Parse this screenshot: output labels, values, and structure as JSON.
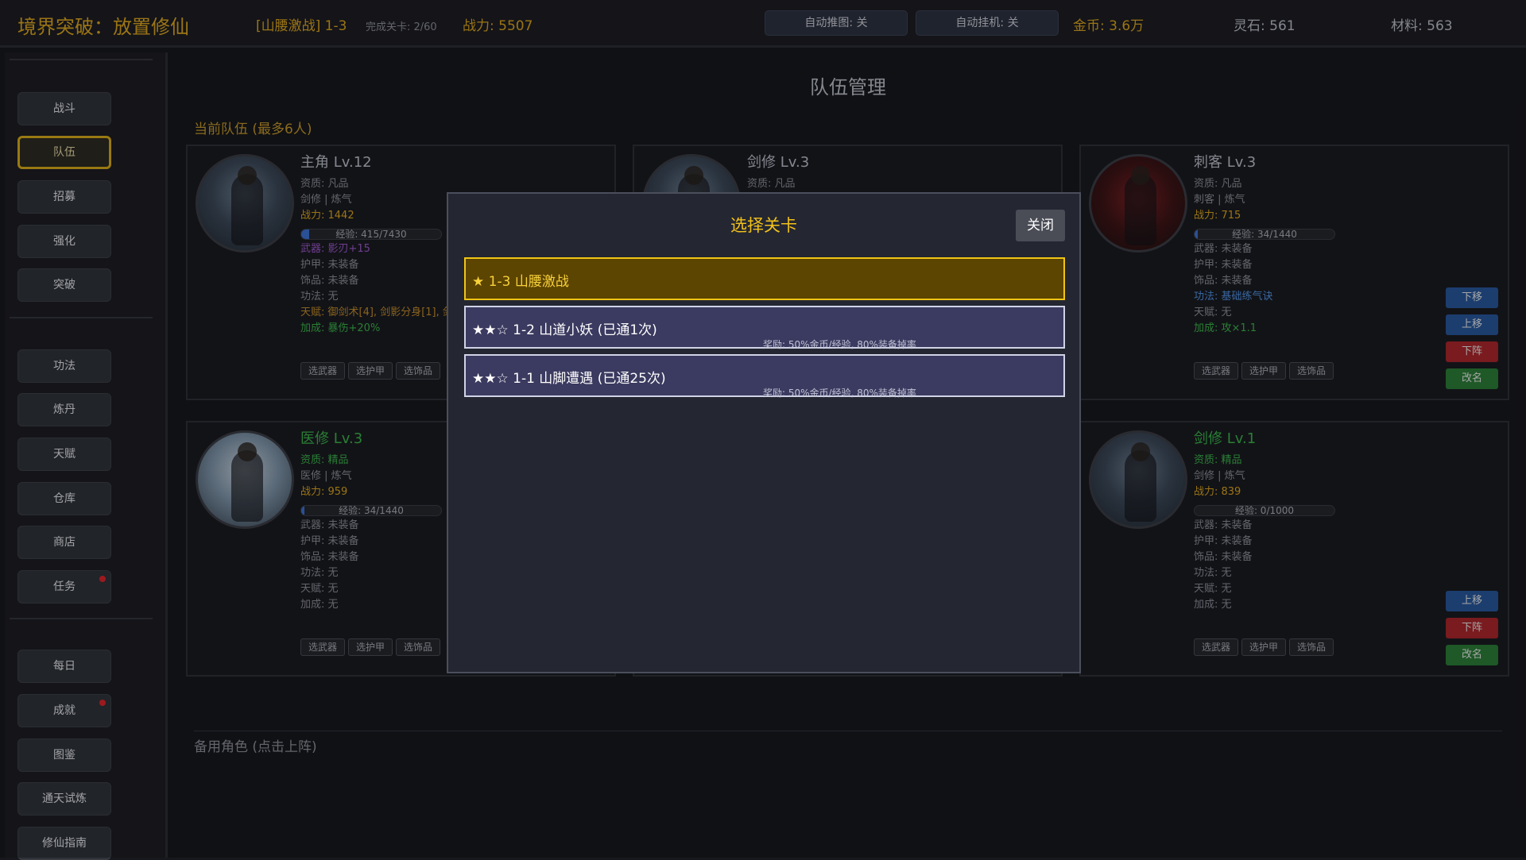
{
  "topbar": {
    "title": "境界突破：放置修仙",
    "stage": "[山腰激战] 1-3",
    "cleared": "完成关卡: 2/60",
    "power": "战力: 5507",
    "auto_push": "自动推图: 关",
    "auto_idle": "自动挂机: 关",
    "gold": "金币: 3.6万",
    "spirit_stone": "灵石: 561",
    "materials": "材料: 563"
  },
  "sidebar": {
    "group1": [
      "战斗",
      "队伍",
      "招募",
      "强化",
      "突破"
    ],
    "group2": [
      "功法",
      "炼丹",
      "天赋",
      "仓库",
      "商店",
      "任务"
    ],
    "group3": [
      "每日",
      "成就",
      "图鉴",
      "通天试炼",
      "修仙指南"
    ],
    "active": "队伍"
  },
  "main": {
    "title": "队伍管理",
    "current_team": "当前队伍 (最多6人)",
    "reserve": "备用角色 (点击上阵)"
  },
  "equip_buttons": [
    "选武器",
    "选护甲",
    "选饰品"
  ],
  "actions": {
    "down": "下移",
    "up": "上移",
    "remove": "下阵",
    "rename": "改名"
  },
  "cards": [
    {
      "name": "主角 Lv.12",
      "aptitude": "资质: 凡品",
      "class": "剑修 | 炼气",
      "power": "战力: 1442",
      "exp": "经验: 415/7430",
      "exp_fraction": 0.056,
      "weapon": "武器: 影刃+15",
      "armor": "护甲: 未装备",
      "accessory": "饰品: 未装备",
      "skill": "功法: 无",
      "talent": "天赋: 御剑术[4], 剑影分身[1], 剑",
      "bonus": "加成: 暴伤+20%"
    },
    {
      "name": "剑修 Lv.3",
      "aptitude": "资质: 凡品"
    },
    {
      "name": "刺客 Lv.3",
      "aptitude": "资质: 凡品",
      "class": "刺客 | 炼气",
      "power": "战力: 715",
      "exp": "经验: 34/1440",
      "exp_fraction": 0.024,
      "weapon": "武器: 未装备",
      "armor": "护甲: 未装备",
      "accessory": "饰品: 未装备",
      "skill": "功法: 基础练气诀",
      "talent": "天赋: 无",
      "bonus": "加成: 攻×1.1"
    },
    {
      "name": "医修 Lv.3",
      "aptitude": "资质: 精品",
      "class": "医修 | 炼气",
      "power": "战力: 959",
      "exp": "经验: 34/1440",
      "exp_fraction": 0.024,
      "weapon": "武器: 未装备",
      "armor": "护甲: 未装备",
      "accessory": "饰品: 未装备",
      "skill": "功法: 无",
      "talent": "天赋: 无",
      "bonus": "加成: 无"
    },
    {
      "name": "剑修 Lv.1",
      "aptitude": "资质: 精品",
      "class": "剑修 | 炼气",
      "power": "战力: 839",
      "exp": "经验: 0/1000",
      "exp_fraction": 0,
      "weapon": "武器: 未装备",
      "armor": "护甲: 未装备",
      "accessory": "饰品: 未装备",
      "skill": "功法: 无",
      "talent": "天赋: 无",
      "bonus": "加成: 无"
    }
  ],
  "modal": {
    "title": "选择关卡",
    "close": "关闭",
    "levels": [
      {
        "label": "★ 1-3 山腰激战",
        "reward": "",
        "selected": true
      },
      {
        "label": "★★☆ 1-2 山道小妖 (已通1次)",
        "reward": "奖励: 50%金币/经验, 80%装备掉率"
      },
      {
        "label": "★★☆ 1-1 山脚遭遇 (已通25次)",
        "reward": "奖励: 50%金币/经验, 80%装备掉率"
      }
    ]
  },
  "colors": {
    "accent_gold": "#d7a21e",
    "modal_title": "#f2c21a",
    "selected_level": "#5c4401",
    "level_bg": "#3b3a60",
    "remove_red": "#a8262c",
    "rename_green": "#2a7c36",
    "move_blue": "#27569a"
  }
}
